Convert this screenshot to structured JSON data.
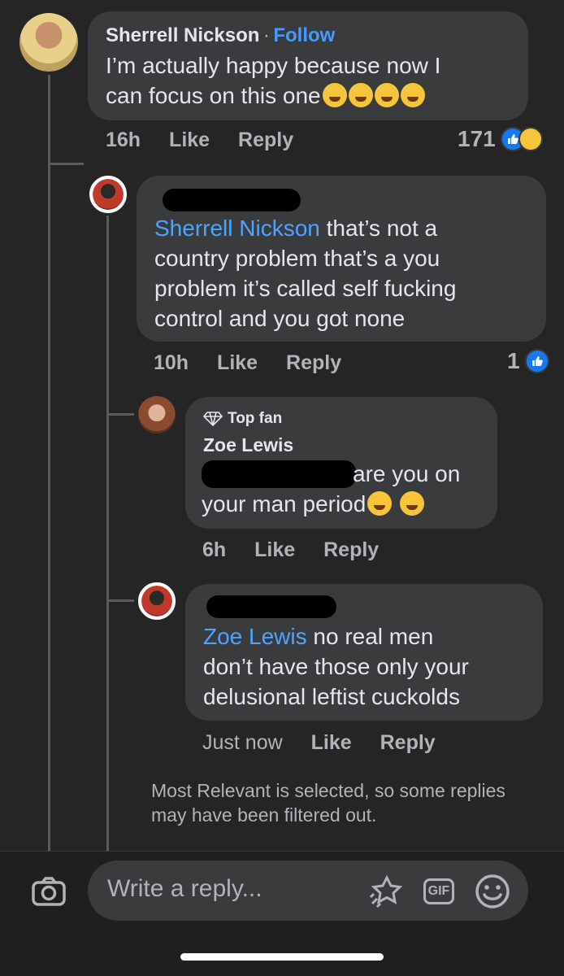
{
  "comment1": {
    "author": "Sherrell Nickson",
    "separator": "·",
    "follow_label": "Follow",
    "text_line1": "I’m actually happy because now I",
    "text_line2": "can focus on this one",
    "time": "16h",
    "like_label": "Like",
    "reply_label": "Reply",
    "reaction_count": "171"
  },
  "reply1": {
    "mention": "Sherrell Nickson",
    "text_line1": " that’s not a",
    "text_line2": "country problem that’s a you",
    "text_line3": "problem it’s called self fucking",
    "text_line4": "control and you got none",
    "time": "10h",
    "like_label": "Like",
    "reply_label": "Reply",
    "reaction_count": "1"
  },
  "reply2": {
    "badge": "Top fan",
    "author": "Zoe Lewis",
    "text_line1": "are you on",
    "text_line2": "your man period",
    "time": "6h",
    "like_label": "Like",
    "reply_label": "Reply"
  },
  "reply3": {
    "mention": "Zoe Lewis",
    "text_line1": " no real men",
    "text_line2": "don’t have those only your",
    "text_line3": "delusional leftist cuckolds",
    "time": "Just now",
    "like_label": "Like",
    "reply_label": "Reply"
  },
  "filter_note": "Most Relevant is selected, so some replies may have been filtered out.",
  "composer": {
    "placeholder": "Write a reply...",
    "gif_label": "GIF",
    "icons": [
      "camera-icon",
      "sticker-icon",
      "gif-icon",
      "emoji-icon"
    ]
  },
  "colors": {
    "background": "#252526",
    "bubble": "#3a3b3c",
    "link": "#4599ff",
    "like_blue": "#1877f2"
  }
}
